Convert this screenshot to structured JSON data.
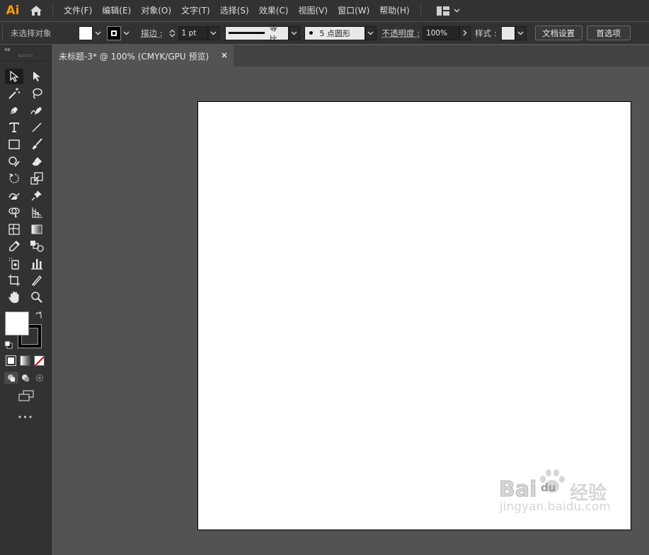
{
  "app": {
    "logo": "Ai"
  },
  "menubar": {
    "items": [
      "文件(F)",
      "编辑(E)",
      "对象(O)",
      "文字(T)",
      "选择(S)",
      "效果(C)",
      "视图(V)",
      "窗口(W)",
      "帮助(H)"
    ]
  },
  "controlbar": {
    "selection_status": "未选择对象",
    "stroke_label": "描边 :",
    "stroke_weight": "1 pt",
    "stroke_profile": "等比",
    "brush": "5 点圆形",
    "opacity_label": "不透明度 :",
    "opacity_value": "100%",
    "style_label": "样式 :",
    "doc_setup_button": "文档设置",
    "preferences_button": "首选项",
    "fill_color": "#ffffff",
    "stroke_color": "#000000"
  },
  "document": {
    "tab_title": "未标题-3* @ 100% (CMYK/GPU 预览)"
  },
  "toolbar": {
    "fill_color": "#ffffff",
    "stroke_color": "#000000",
    "more_label": "•••",
    "tools": [
      "selection",
      "direct-selection",
      "magic-wand",
      "lasso",
      "pen",
      "curvature",
      "type",
      "line-segment",
      "rectangle",
      "paintbrush",
      "shaper",
      "eraser",
      "rotate",
      "scale",
      "warp",
      "puppet-warp",
      "shape-builder",
      "perspective-grid",
      "mesh",
      "gradient",
      "eyedropper",
      "blend",
      "symbol-sprayer",
      "column-graph",
      "artboard",
      "slice",
      "hand",
      "zoom"
    ]
  },
  "watermark": {
    "brand": "Bai",
    "brand2": "du",
    "brand_cn": "经验",
    "url": "jingyan.baidu.com"
  }
}
